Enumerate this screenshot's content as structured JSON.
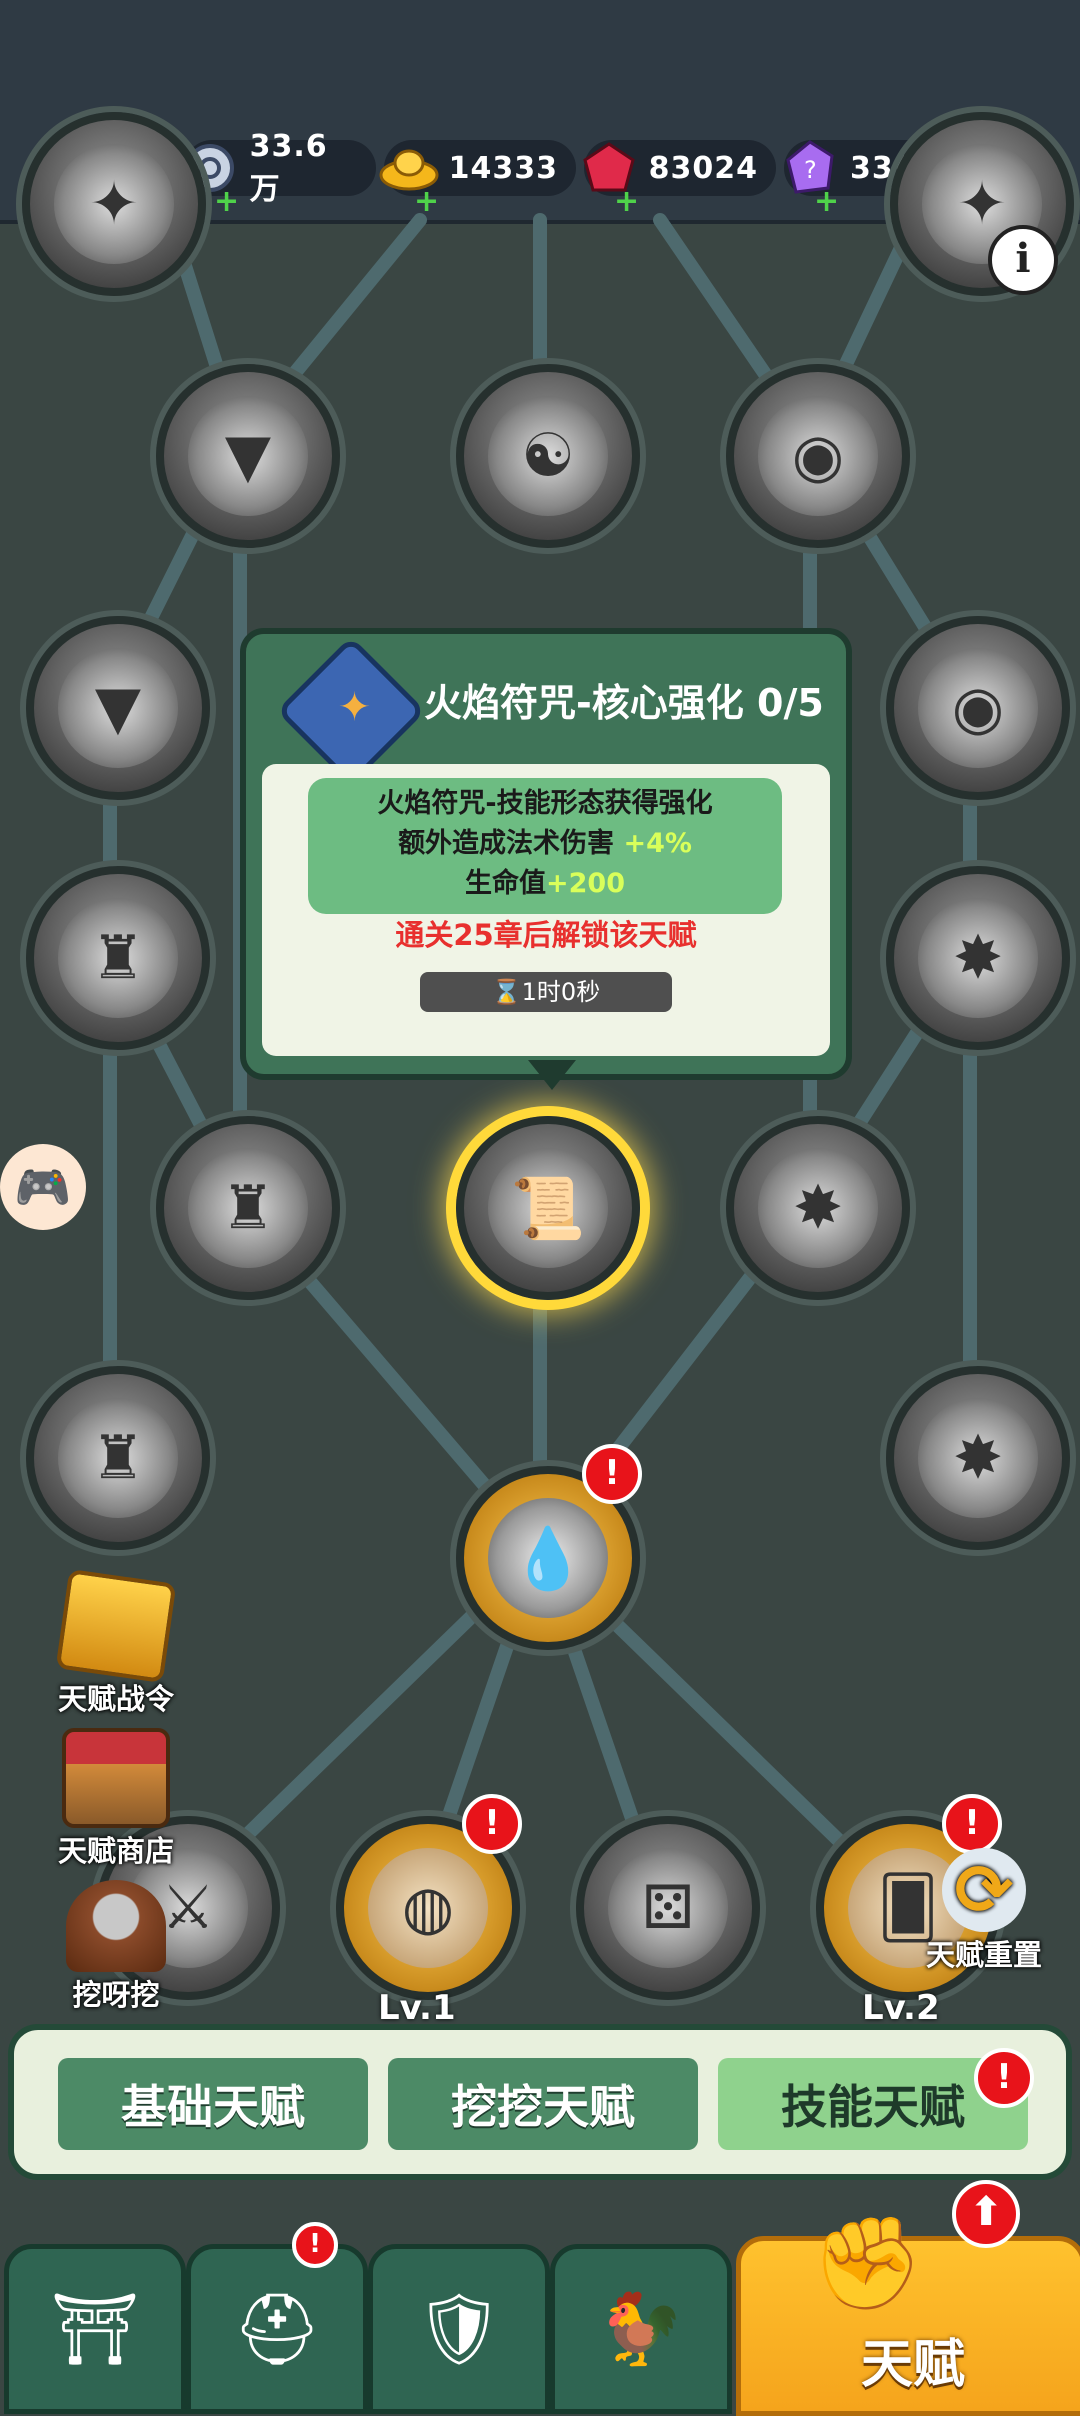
{
  "resources": [
    {
      "name": "silver-coin",
      "value": "33.6万"
    },
    {
      "name": "gold-ingot",
      "value": "14333"
    },
    {
      "name": "red-gem",
      "value": "83024"
    },
    {
      "name": "purple-crystal",
      "value": "3396"
    }
  ],
  "tooltip": {
    "title": "火焰符咒-核心强化 0/5",
    "desc_line1": "火焰符咒-技能形态获得强化",
    "desc_line2_text": "额外造成法术伤害 ",
    "desc_line2_value": "+4%",
    "desc_line3_text": "生命值",
    "desc_line3_value": "+200",
    "lock_text": "通关25章后解锁该天赋",
    "timer": "⌛1时0秒"
  },
  "side": {
    "pass": "天赋战令",
    "shop": "天赋商店",
    "dig": "挖呀挖",
    "reset": "天赋重置"
  },
  "levels": {
    "left": "Lv.1",
    "right": "Lv.2"
  },
  "tabs": {
    "basic": "基础天赋",
    "dig": "挖挖天赋",
    "skill": "技能天赋"
  },
  "nav": {
    "talent": "天赋"
  },
  "badge_text": "!",
  "info_text": "i"
}
